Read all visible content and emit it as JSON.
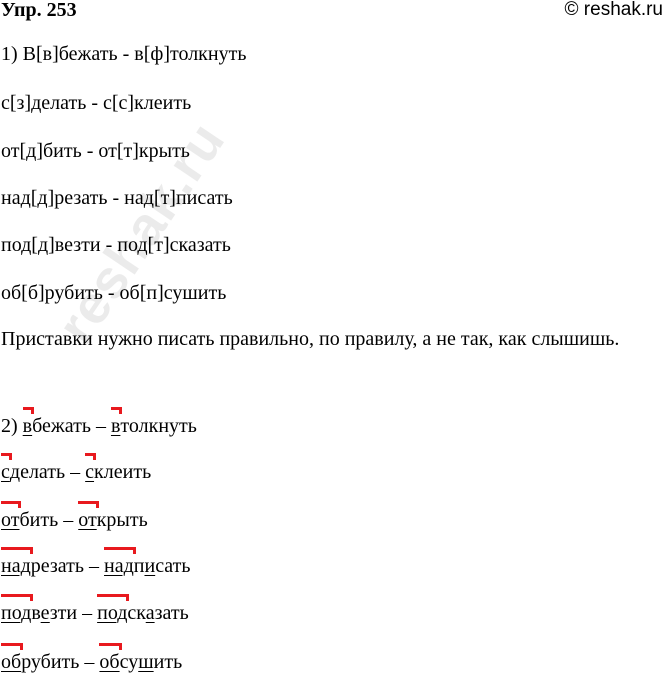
{
  "header": {
    "title": "Упр. 253",
    "source": "© reshak.ru"
  },
  "watermark": "reshak.ru",
  "part1": [
    "1) В[в]бежать - в[ф]толкнуть",
    "с[з]делать - с[с]клеить",
    "от[д]бить - от[т]крыть",
    "над[д]резать - над[т]писать",
    "под[д]везти - под[т]сказать",
    "об[б]рубить - об[п]сушить"
  ],
  "rule": "Приставки нужно писать правильно, по правилу, а не так, как слышишь.",
  "part2": {
    "number": "2)",
    "dash": "–",
    "rows": [
      {
        "w1": {
          "prefix": "в",
          "rest": [
            {
              "t": "бежать"
            }
          ]
        },
        "w2": {
          "prefix": "в",
          "rest": [
            {
              "t": "толкнуть"
            }
          ]
        }
      },
      {
        "w1": {
          "prefix": "с",
          "rest": [
            {
              "t": "делать"
            }
          ]
        },
        "w2": {
          "prefix": "с",
          "rest": [
            {
              "t": "клеить"
            }
          ]
        }
      },
      {
        "w1": {
          "prefix": "от",
          "rest": [
            {
              "t": "бить"
            }
          ]
        },
        "w2": {
          "prefix": "от",
          "rest": [
            {
              "t": "крыть"
            }
          ]
        }
      },
      {
        "w1": {
          "prefix": "над",
          "rest": [
            {
              "t": "резать"
            }
          ]
        },
        "w2": {
          "prefix": "над",
          "rest": [
            {
              "t": "п"
            },
            {
              "t": "и",
              "u": true
            },
            {
              "t": "сать"
            }
          ]
        }
      },
      {
        "w1": {
          "prefix": "под",
          "rest": [
            {
              "t": "в"
            },
            {
              "t": "е",
              "u": true
            },
            {
              "t": "зти"
            }
          ]
        },
        "w2": {
          "prefix": "под",
          "rest": [
            {
              "t": "ск"
            },
            {
              "t": "а",
              "u": true
            },
            {
              "t": "зать"
            }
          ]
        }
      },
      {
        "w1": {
          "prefix": "об",
          "rest": [
            {
              "t": "рубить"
            }
          ]
        },
        "w2": {
          "prefix": "об",
          "rest": [
            {
              "t": "су"
            },
            {
              "t": "ш",
              "u": true
            },
            {
              "t": "ить"
            }
          ]
        }
      }
    ]
  }
}
